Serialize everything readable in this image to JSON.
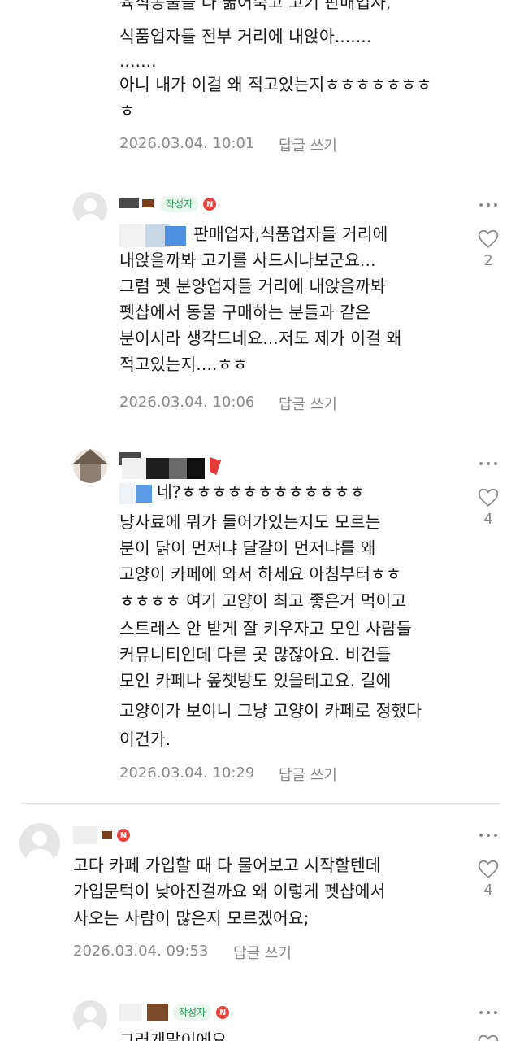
{
  "comments": [
    {
      "id": "c0",
      "lines": [
        "육식동물들 다 굶어죽고 고기 판매업자,",
        "식품업자들 전부 거리에 내앉아.......",
        ".......",
        "아니 내가 이걸 왜 적고있는지ㅎㅎㅎㅎㅎㅎㅎ",
        "ㅎ"
      ],
      "date": "2026.03.04. 10:01",
      "reply": "답글 쓰기"
    },
    {
      "id": "c1",
      "badge": "작성자",
      "badge_n": "N",
      "lines": [
        "판매업자,식품업자들 거리에",
        "내앉을까봐 고기를 사드시나보군요...",
        "그럼 펫 분양업자들 거리에 내앉을까봐",
        "펫샵에서 동물 구매하는 분들과 같은",
        "분이시라 생각드네요...저도 제가 이걸 왜",
        "적고있는지....ㅎㅎ"
      ],
      "date": "2026.03.04. 10:06",
      "reply": "답글 쓰기",
      "likes": "2"
    },
    {
      "id": "c2",
      "lines": [
        "네?ㅎㅎㅎㅎㅎㅎㅎㅎㅎㅎㅎㅎ",
        "냥사료에 뭐가 들어가있는지도 모르는",
        "분이 닭이 먼저냐 달걀이 먼저냐를 왜",
        "고양이 카페에 와서 하세요 아침부터ㅎㅎ",
        "ㅎㅎㅎㅎ 여기 고양이 최고 좋은거 먹이고",
        "스트레스 안 받게 잘 키우자고 모인 사람들",
        "커뮤니티인데 다른 곳 많잖아요. 비건들",
        "모인 카페나 옾챗방도 있을테고요. 길에",
        "고양이가 보이니 그냥 고양이 카페로 정했다",
        "이건가."
      ],
      "date": "2026.03.04. 10:29",
      "reply": "답글 쓰기",
      "likes": "4"
    },
    {
      "id": "c3",
      "badge_n": "N",
      "lines": [
        "고다 카페 가입할 때 다 물어보고 시작할텐데",
        "가입문턱이 낮아진걸까요 왜 이렇게 펫샵에서",
        "사오는 사람이 많은지 모르겠어요;"
      ],
      "date": "2026.03.04. 09:53",
      "reply": "답글 쓰기",
      "likes": "4"
    },
    {
      "id": "c4",
      "badge": "작성자",
      "badge_n": "N",
      "lines": [
        "그러게말이에요"
      ]
    }
  ]
}
